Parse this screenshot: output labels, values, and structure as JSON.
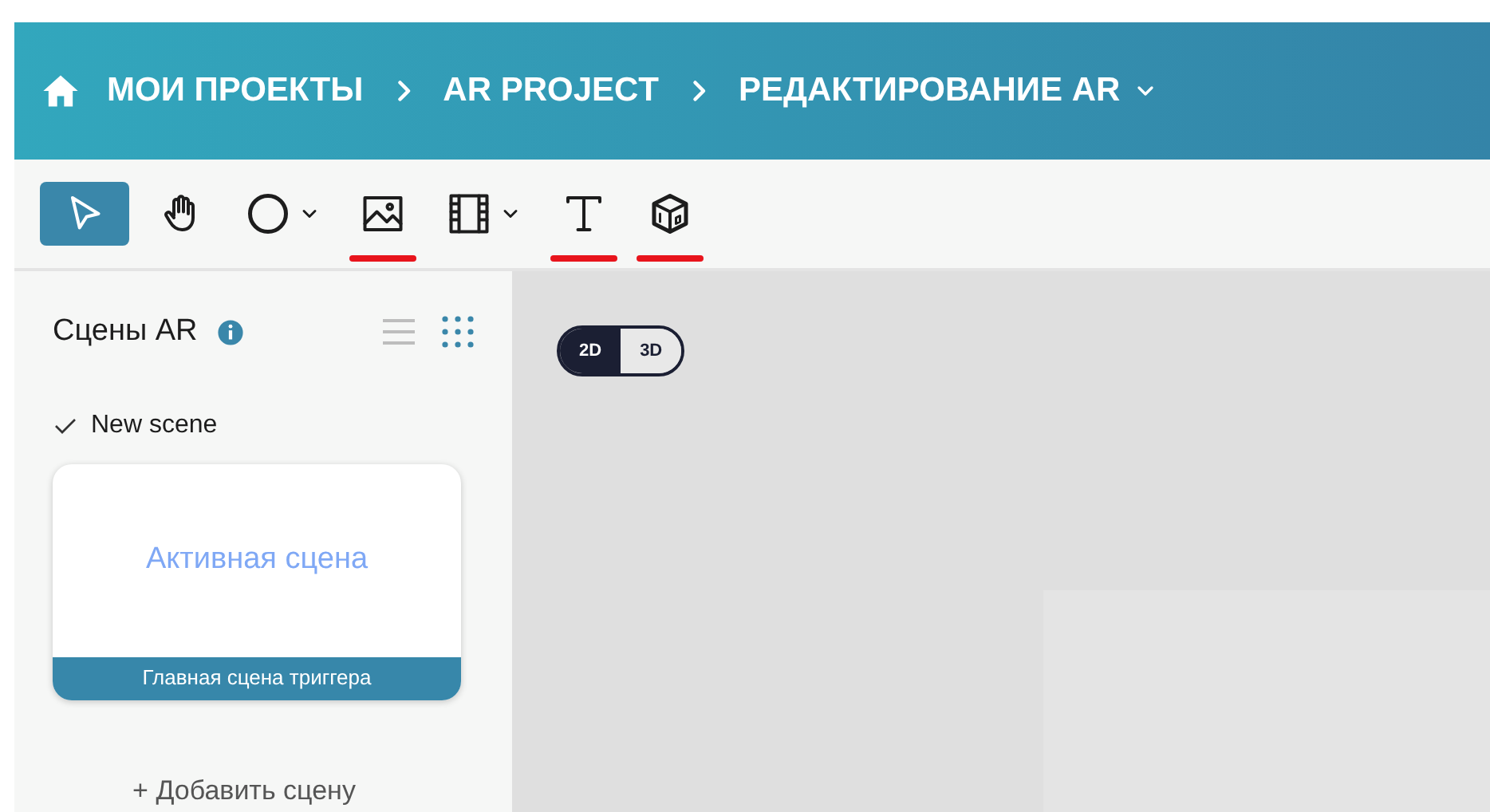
{
  "breadcrumbs": [
    {
      "label": "МОИ ПРОЕКТЫ",
      "dropdown": false
    },
    {
      "label": "AR PROJECT",
      "dropdown": false
    },
    {
      "label": "РЕДАКТИРОВАНИЕ AR",
      "dropdown": true
    }
  ],
  "tools": [
    {
      "kind": "pointer",
      "selected": true,
      "dropdown": false,
      "highlighted": false
    },
    {
      "kind": "hand",
      "selected": false,
      "dropdown": false,
      "highlighted": false
    },
    {
      "kind": "circle",
      "selected": false,
      "dropdown": true,
      "highlighted": false
    },
    {
      "kind": "image",
      "selected": false,
      "dropdown": false,
      "highlighted": true
    },
    {
      "kind": "film",
      "selected": false,
      "dropdown": true,
      "highlighted": false
    },
    {
      "kind": "text",
      "selected": false,
      "dropdown": false,
      "highlighted": true
    },
    {
      "kind": "cube",
      "selected": false,
      "dropdown": false,
      "highlighted": true
    }
  ],
  "sidebar": {
    "title": "Сцены AR",
    "views": [
      {
        "kind": "list",
        "selected": false
      },
      {
        "kind": "grid",
        "selected": true
      }
    ],
    "group": {
      "label": "New scene",
      "expanded": true
    },
    "scene_card": {
      "preview": "Активная сцена",
      "caption": "Главная сцена триггера"
    },
    "add_button": "+ Добавить сцену"
  },
  "view_toggle": [
    {
      "label": "2D",
      "selected": true
    },
    {
      "label": "3D",
      "selected": false
    }
  ]
}
